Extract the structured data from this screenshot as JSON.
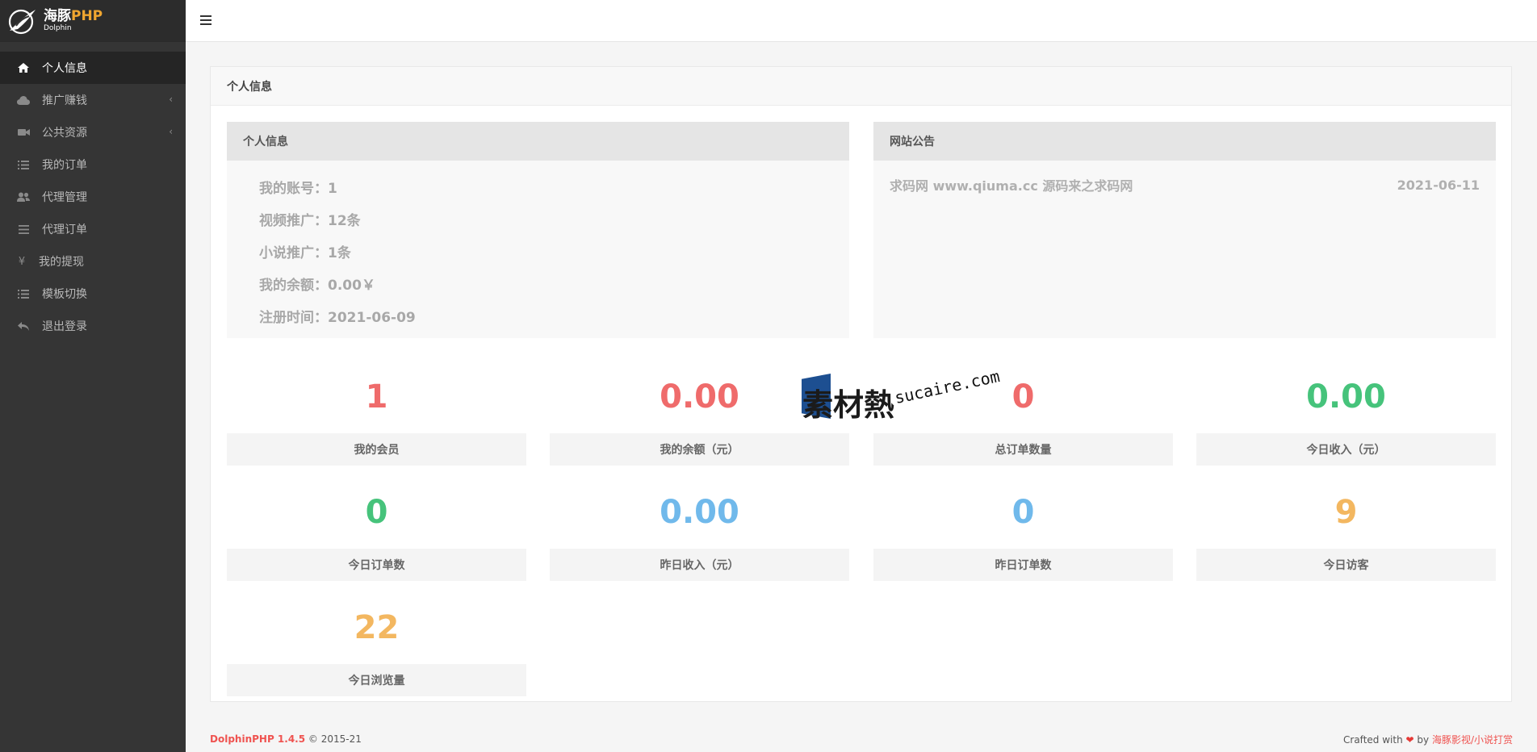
{
  "brand": {
    "name": "海豚",
    "name_php": "PHP",
    "sub": "Dolphin"
  },
  "sidebar": {
    "items": [
      {
        "label": "个人信息",
        "icon": "home-icon",
        "active": true,
        "has_children": false
      },
      {
        "label": "推广赚钱",
        "icon": "cloud-icon",
        "active": false,
        "has_children": true
      },
      {
        "label": "公共资源",
        "icon": "video-camera-icon",
        "active": false,
        "has_children": true
      },
      {
        "label": "我的订单",
        "icon": "list-icon",
        "active": false,
        "has_children": false
      },
      {
        "label": "代理管理",
        "icon": "users-icon",
        "active": false,
        "has_children": false
      },
      {
        "label": "代理订单",
        "icon": "bars-icon",
        "active": false,
        "has_children": false
      },
      {
        "label": "我的提现",
        "icon": "yen-icon",
        "active": false,
        "has_children": false
      },
      {
        "label": "模板切换",
        "icon": "list-icon",
        "active": false,
        "has_children": false
      },
      {
        "label": "退出登录",
        "icon": "reply-icon",
        "active": false,
        "has_children": false
      }
    ]
  },
  "panel": {
    "title": "个人信息"
  },
  "profile": {
    "title": "个人信息",
    "lines": [
      "我的账号：1",
      "视频推广：12条",
      "小说推广：1条",
      "我的余额：0.00￥",
      "注册时间：2021-06-09"
    ]
  },
  "notice": {
    "title": "网站公告",
    "items": [
      {
        "text": "求码网 www.qiuma.cc 源码来之求码网",
        "date": "2021-06-11"
      }
    ]
  },
  "stats": [
    {
      "value": "1",
      "label": "我的会员",
      "color": "#ef6b6b"
    },
    {
      "value": "0.00",
      "label": "我的余额（元）",
      "color": "#ef6b6b"
    },
    {
      "value": "0",
      "label": "总订单数量",
      "color": "#ef6b6b"
    },
    {
      "value": "0.00",
      "label": "今日收入（元）",
      "color": "#46c37b"
    },
    {
      "value": "0",
      "label": "今日订单数",
      "color": "#46c37b"
    },
    {
      "value": "0.00",
      "label": "昨日收入（元）",
      "color": "#70b9eb"
    },
    {
      "value": "0",
      "label": "昨日订单数",
      "color": "#70b9eb"
    },
    {
      "value": "9",
      "label": "今日访客",
      "color": "#f3b760"
    },
    {
      "value": "22",
      "label": "今日浏览量",
      "color": "#f3b760"
    }
  ],
  "watermark": {
    "cn": "素材熱",
    "en": "sucaire.com"
  },
  "footer": {
    "product": "DolphinPHP 1.4.5",
    "copyright": "© 2015-21",
    "crafted": "Crafted with",
    "by": "by",
    "link": "海豚影视/小说打赏"
  }
}
